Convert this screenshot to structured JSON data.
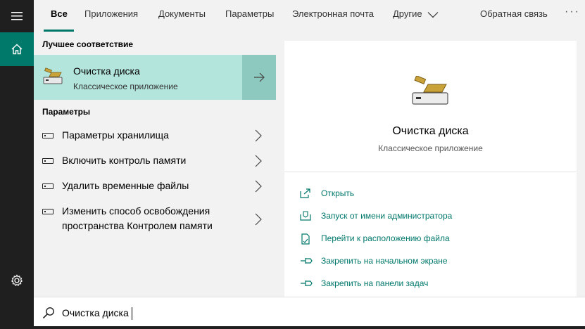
{
  "tabs": {
    "all": "Все",
    "apps": "Приложения",
    "documents": "Документы",
    "settings": "Параметры",
    "email": "Электронная почта",
    "other": "Другие",
    "feedback": "Обратная связь",
    "more": "···"
  },
  "results": {
    "best_match_title": "Лучшее соответствие",
    "best": {
      "title": "Очистка диска",
      "subtitle": "Классическое приложение"
    },
    "settings_title": "Параметры",
    "settings_items": [
      {
        "label": "Параметры хранилища"
      },
      {
        "label": "Включить контроль памяти"
      },
      {
        "label": "Удалить временные файлы"
      },
      {
        "label": "Изменить способ освобождения пространства Контролем памяти"
      }
    ]
  },
  "detail": {
    "title": "Очистка диска",
    "subtitle": "Классическое приложение",
    "actions": [
      {
        "label": "Открыть",
        "icon": "open-icon"
      },
      {
        "label": "Запуск от имени администратора",
        "icon": "shield-icon"
      },
      {
        "label": "Перейти к расположению файла",
        "icon": "file-location-icon"
      },
      {
        "label": "Закрепить на начальном экране",
        "icon": "pin-icon"
      },
      {
        "label": "Закрепить на панели задач",
        "icon": "pin-icon"
      }
    ]
  },
  "search": {
    "value": "Очистка диска"
  },
  "colors": {
    "accent": "#00786a",
    "best_bg": "#b3e5dd",
    "rail": "#1f1f1f"
  }
}
